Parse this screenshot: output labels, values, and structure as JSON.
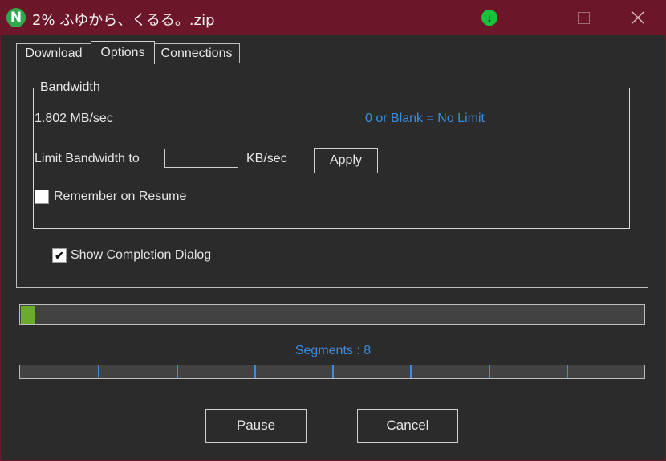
{
  "window": {
    "title": "2%  ふゆから、くるる。.zip",
    "app_icon_letter": "N",
    "download_indicator": "↓"
  },
  "tabs": [
    {
      "label": "Download",
      "active": false
    },
    {
      "label": "Options",
      "active": true
    },
    {
      "label": "Connections",
      "active": false
    }
  ],
  "bandwidth": {
    "group_label": "Bandwidth",
    "current_rate": "1.802 MB/sec",
    "hint": "0 or Blank = No Limit",
    "limit_label": "Limit Bandwidth to",
    "limit_value": "",
    "unit": "KB/sec",
    "apply_label": "Apply",
    "remember_label": "Remember on Resume",
    "remember_checked": false
  },
  "show_completion": {
    "label": "Show Completion Dialog",
    "checked": true,
    "check_glyph": "✔"
  },
  "progress": {
    "fraction": 0.02
  },
  "segments": {
    "label": "Segments : 8",
    "count": 8
  },
  "buttons": {
    "pause": "Pause",
    "cancel": "Cancel"
  },
  "colors": {
    "titlebar": "#6b1729",
    "accent_blue": "#3c8de0",
    "progress_green": "#6aab2e",
    "indicator_green": "#18c23a"
  }
}
